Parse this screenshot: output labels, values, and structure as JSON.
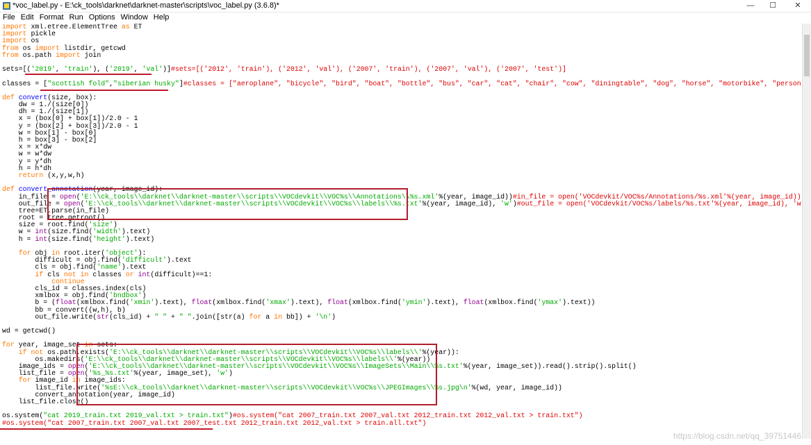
{
  "window": {
    "title": "*voc_label.py - E:\\ck_tools\\darknet\\darknet-master\\scripts\\voc_label.py (3.6.8)*",
    "controls": {
      "minimize": "—",
      "maximize": "☐",
      "close": "✕"
    }
  },
  "menu": [
    "File",
    "Edit",
    "Format",
    "Run",
    "Options",
    "Window",
    "Help"
  ],
  "code_lines": [
    [
      [
        "kw",
        "import"
      ],
      [
        "t",
        " xml.etree.ElementTree "
      ],
      [
        "kw",
        "as"
      ],
      [
        "t",
        " ET"
      ]
    ],
    [
      [
        "kw",
        "import"
      ],
      [
        "t",
        " pickle"
      ]
    ],
    [
      [
        "kw",
        "import"
      ],
      [
        "t",
        " os"
      ]
    ],
    [
      [
        "kw",
        "from"
      ],
      [
        "t",
        " os "
      ],
      [
        "kw",
        "import"
      ],
      [
        "t",
        " listdir, getcwd"
      ]
    ],
    [
      [
        "kw",
        "from"
      ],
      [
        "t",
        " os.path "
      ],
      [
        "kw",
        "import"
      ],
      [
        "t",
        " join"
      ]
    ],
    [
      [
        "t",
        ""
      ]
    ],
    [
      [
        "t",
        "sets=[("
      ],
      [
        "str",
        "'2019'"
      ],
      [
        "t",
        ", "
      ],
      [
        "str",
        "'train'"
      ],
      [
        "t",
        "), ("
      ],
      [
        "str",
        "'2019'"
      ],
      [
        "t",
        ", "
      ],
      [
        "str",
        "'val'"
      ],
      [
        "t",
        ")]"
      ],
      [
        "cm",
        "#sets=[('2012', 'train'), ('2012', 'val'), ('2007', 'train'), ('2007', 'val'), ('2007', 'test')]"
      ]
    ],
    [
      [
        "t",
        ""
      ]
    ],
    [
      [
        "t",
        "classes = ["
      ],
      [
        "str",
        "\"scottish fold\""
      ],
      [
        "t",
        ","
      ],
      [
        "str",
        "\"siberian husky\""
      ],
      [
        "t",
        "]"
      ],
      [
        "cm",
        "#classes = [\"aeroplane\", \"bicycle\", \"bird\", \"boat\", \"bottle\", \"bus\", \"car\", \"cat\", \"chair\", \"cow\", \"diningtable\", \"dog\", \"horse\", \"motorbike\", \"person\", \"pottedplant\""
      ]
    ],
    [
      [
        "t",
        ""
      ]
    ],
    [
      [
        "kw",
        "def"
      ],
      [
        "t",
        " "
      ],
      [
        "fn",
        "convert"
      ],
      [
        "t",
        "(size, box):"
      ]
    ],
    [
      [
        "t",
        "    dw = 1./(size[0])"
      ]
    ],
    [
      [
        "t",
        "    dh = 1./(size[1])"
      ]
    ],
    [
      [
        "t",
        "    x = (box[0] + box[1])/2.0 - 1"
      ]
    ],
    [
      [
        "t",
        "    y = (box[2] + box[3])/2.0 - 1"
      ]
    ],
    [
      [
        "t",
        "    w = box[1] - box[0]"
      ]
    ],
    [
      [
        "t",
        "    h = box[3] - box[2]"
      ]
    ],
    [
      [
        "t",
        "    x = x*dw"
      ]
    ],
    [
      [
        "t",
        "    w = w*dw"
      ]
    ],
    [
      [
        "t",
        "    y = y*dh"
      ]
    ],
    [
      [
        "t",
        "    h = h*dh"
      ]
    ],
    [
      [
        "t",
        "    "
      ],
      [
        "kw",
        "return"
      ],
      [
        "t",
        " (x,y,w,h)"
      ]
    ],
    [
      [
        "t",
        ""
      ]
    ],
    [
      [
        "kw",
        "def"
      ],
      [
        "t",
        " "
      ],
      [
        "fn",
        "convert_annotation"
      ],
      [
        "t",
        "(year, image_id):"
      ]
    ],
    [
      [
        "t",
        "    in_file = "
      ],
      [
        "bi",
        "open"
      ],
      [
        "t",
        "("
      ],
      [
        "str",
        "'E:\\\\ck_tools\\\\darknet\\\\darknet-master\\\\scripts\\\\VOCdevkit\\\\VOC%s\\\\Annotations\\\\%s.xml'"
      ],
      [
        "t",
        "%(year, image_id))"
      ],
      [
        "cm",
        "#in_file = open('VOCdevkit/VOC%s/Annotations/%s.xml'%(year, image_id))"
      ]
    ],
    [
      [
        "t",
        "    out_file = "
      ],
      [
        "bi",
        "open"
      ],
      [
        "t",
        "("
      ],
      [
        "str",
        "'E:\\\\ck_tools\\\\darknet\\\\darknet-master\\\\scripts\\\\VOCdevkit\\\\VOC%s\\\\labels\\\\%s.txt'"
      ],
      [
        "t",
        "%(year, image_id), "
      ],
      [
        "str",
        "'w'"
      ],
      [
        "t",
        ")"
      ],
      [
        "cm",
        "#out_file = open('VOCdevkit/VOC%s/labels/%s.txt'%(year, image_id), 'w')"
      ]
    ],
    [
      [
        "t",
        "    tree=ET.parse(in_file)"
      ]
    ],
    [
      [
        "t",
        "    root = tree.getroot()"
      ]
    ],
    [
      [
        "t",
        "    size = root.find("
      ],
      [
        "str",
        "'size'"
      ],
      [
        "t",
        ")"
      ]
    ],
    [
      [
        "t",
        "    w = "
      ],
      [
        "bi",
        "int"
      ],
      [
        "t",
        "(size.find("
      ],
      [
        "str",
        "'width'"
      ],
      [
        "t",
        ").text)"
      ]
    ],
    [
      [
        "t",
        "    h = "
      ],
      [
        "bi",
        "int"
      ],
      [
        "t",
        "(size.find("
      ],
      [
        "str",
        "'height'"
      ],
      [
        "t",
        ").text)"
      ]
    ],
    [
      [
        "t",
        ""
      ]
    ],
    [
      [
        "t",
        "    "
      ],
      [
        "kw",
        "for"
      ],
      [
        "t",
        " obj "
      ],
      [
        "kw",
        "in"
      ],
      [
        "t",
        " root.iter("
      ],
      [
        "str",
        "'object'"
      ],
      [
        "t",
        "):"
      ]
    ],
    [
      [
        "t",
        "        difficult = obj.find("
      ],
      [
        "str",
        "'difficult'"
      ],
      [
        "t",
        ").text"
      ]
    ],
    [
      [
        "t",
        "        cls = obj.find("
      ],
      [
        "str",
        "'name'"
      ],
      [
        "t",
        ").text"
      ]
    ],
    [
      [
        "t",
        "        "
      ],
      [
        "kw",
        "if"
      ],
      [
        "t",
        " cls "
      ],
      [
        "kw",
        "not in"
      ],
      [
        "t",
        " classes "
      ],
      [
        "kw",
        "or"
      ],
      [
        "t",
        " "
      ],
      [
        "bi",
        "int"
      ],
      [
        "t",
        "(difficult)==1:"
      ]
    ],
    [
      [
        "t",
        "            "
      ],
      [
        "kw",
        "continue"
      ]
    ],
    [
      [
        "t",
        "        cls_id = classes.index(cls)"
      ]
    ],
    [
      [
        "t",
        "        xmlbox = obj.find("
      ],
      [
        "str",
        "'bndbox'"
      ],
      [
        "t",
        ")"
      ]
    ],
    [
      [
        "t",
        "        b = ("
      ],
      [
        "bi",
        "float"
      ],
      [
        "t",
        "(xmlbox.find("
      ],
      [
        "str",
        "'xmin'"
      ],
      [
        "t",
        ").text), "
      ],
      [
        "bi",
        "float"
      ],
      [
        "t",
        "(xmlbox.find("
      ],
      [
        "str",
        "'xmax'"
      ],
      [
        "t",
        ").text), "
      ],
      [
        "bi",
        "float"
      ],
      [
        "t",
        "(xmlbox.find("
      ],
      [
        "str",
        "'ymin'"
      ],
      [
        "t",
        ").text), "
      ],
      [
        "bi",
        "float"
      ],
      [
        "t",
        "(xmlbox.find("
      ],
      [
        "str",
        "'ymax'"
      ],
      [
        "t",
        ").text))"
      ]
    ],
    [
      [
        "t",
        "        bb = convert((w,h), b)"
      ]
    ],
    [
      [
        "t",
        "        out_file.write("
      ],
      [
        "bi",
        "str"
      ],
      [
        "t",
        "(cls_id) + "
      ],
      [
        "str",
        "\" \""
      ],
      [
        "t",
        " + "
      ],
      [
        "str",
        "\" \""
      ],
      [
        "t",
        ".join([str(a) "
      ],
      [
        "kw",
        "for"
      ],
      [
        "t",
        " a "
      ],
      [
        "kw",
        "in"
      ],
      [
        "t",
        " bb]) + "
      ],
      [
        "str",
        "'\\n'"
      ],
      [
        "t",
        ")"
      ]
    ],
    [
      [
        "t",
        ""
      ]
    ],
    [
      [
        "t",
        "wd = getcwd()"
      ]
    ],
    [
      [
        "t",
        ""
      ]
    ],
    [
      [
        "kw",
        "for"
      ],
      [
        "t",
        " year, image_set "
      ],
      [
        "kw",
        "in"
      ],
      [
        "t",
        " sets:"
      ]
    ],
    [
      [
        "t",
        "    "
      ],
      [
        "kw",
        "if not"
      ],
      [
        "t",
        " os.path.exists("
      ],
      [
        "str",
        "'E:\\\\ck_tools\\\\darknet\\\\darknet-master\\\\scripts\\\\VOCdevkit\\\\VOC%s\\\\labels\\\\'"
      ],
      [
        "t",
        "%(year)):"
      ]
    ],
    [
      [
        "t",
        "        os.makedirs("
      ],
      [
        "str",
        "'E:\\\\ck_tools\\\\darknet\\\\darknet-master\\\\scripts\\\\VOCdevkit\\\\VOC%s\\\\labels\\\\'"
      ],
      [
        "t",
        "%(year))"
      ]
    ],
    [
      [
        "t",
        "    image_ids = "
      ],
      [
        "bi",
        "open"
      ],
      [
        "t",
        "("
      ],
      [
        "str",
        "'E:\\\\ck_tools\\\\darknet\\\\darknet-master\\\\scripts\\\\VOCdevkit\\\\VOC%s\\\\ImageSets\\\\Main\\\\%s.txt'"
      ],
      [
        "t",
        "%(year, image_set)).read().strip().split()"
      ]
    ],
    [
      [
        "t",
        "    list_file = "
      ],
      [
        "bi",
        "open"
      ],
      [
        "t",
        "("
      ],
      [
        "str",
        "'%s_%s.txt'"
      ],
      [
        "t",
        "%(year, image_set), "
      ],
      [
        "str",
        "'w'"
      ],
      [
        "t",
        ")"
      ]
    ],
    [
      [
        "t",
        "    "
      ],
      [
        "kw",
        "for"
      ],
      [
        "t",
        " image_id "
      ],
      [
        "kw",
        "in"
      ],
      [
        "t",
        " image_ids:"
      ]
    ],
    [
      [
        "t",
        "        list_file.write("
      ],
      [
        "str",
        "'%sE:\\\\ck_tools\\\\darknet\\\\darknet-master\\\\scripts\\\\VOCdevkit\\\\VOC%s\\\\JPEGImages\\\\%s.jpg\\n'"
      ],
      [
        "t",
        "%(wd, year, image_id))"
      ]
    ],
    [
      [
        "t",
        "        convert_annotation(year, image_id)"
      ]
    ],
    [
      [
        "t",
        "    list_file.close()"
      ]
    ],
    [
      [
        "t",
        ""
      ]
    ],
    [
      [
        "t",
        "os.system("
      ],
      [
        "str",
        "\"cat 2019_train.txt 2019_val.txt > train.txt\""
      ],
      [
        "t",
        ")"
      ],
      [
        "cm",
        "#os.system(\"cat 2007_train.txt 2007_val.txt 2012_train.txt 2012_val.txt > train.txt\")"
      ]
    ],
    [
      [
        "cm",
        "#os.system(\"cat 2007_train.txt 2007_val.txt 2007_test.txt 2012_train.txt 2012_val.txt > train.all.txt\")"
      ]
    ]
  ],
  "watermark": "https://blog.csdn.net/qq_39751446",
  "colors": {
    "annotation_red": "#b01e2a",
    "keyword": "#ff7700",
    "string": "#00aa00",
    "comment": "#dd0000",
    "builtin": "#900090",
    "defname": "#0000ff"
  }
}
